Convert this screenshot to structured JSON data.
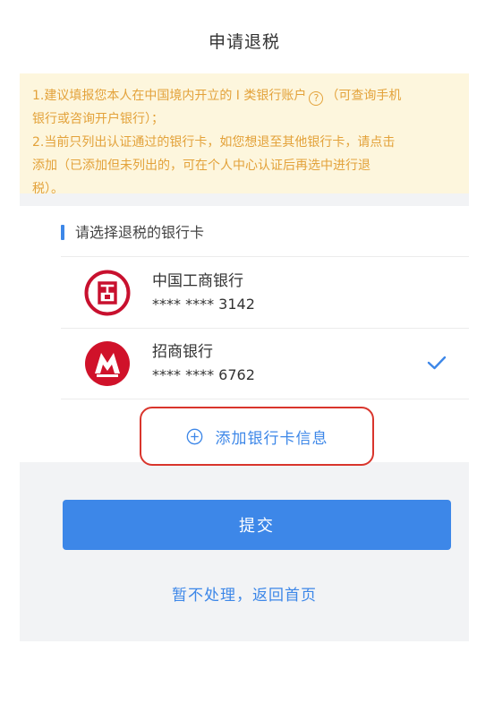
{
  "header": {
    "title": "申请退税"
  },
  "notice": {
    "line1_before": "1.建议填报您本人在中国境内开立的 I 类银行账户",
    "help_symbol": "?",
    "line1_after": "（可查询手机",
    "line2": "银行或咨询开户银行）；",
    "line3": "2.当前只列出认证通过的银行卡，如您想退至其他银行卡，请点击",
    "line4": "添加（已添加但未列出的，可在个人中心认证后再选中进行退",
    "line5": "税）。"
  },
  "section": {
    "title": "请选择退税的银行卡"
  },
  "cards": [
    {
      "name": "中国工商银行",
      "number": "**** **** 3142",
      "selected": false,
      "logo_color": "#c8102e",
      "logo": "icbc-logo-icon"
    },
    {
      "name": "招商银行",
      "number": "**** **** 6762",
      "selected": true,
      "logo_color": "#d0122a",
      "logo": "cmb-logo-icon"
    }
  ],
  "add_card": {
    "label": "添加银行卡信息"
  },
  "submit": {
    "label": "提交"
  },
  "later": {
    "label": "暂不处理，返回首页"
  },
  "colors": {
    "accent": "#3d87e8",
    "notice_text": "#e3a23a",
    "notice_bg": "#fdf6dd",
    "highlight": "#d9352c"
  }
}
